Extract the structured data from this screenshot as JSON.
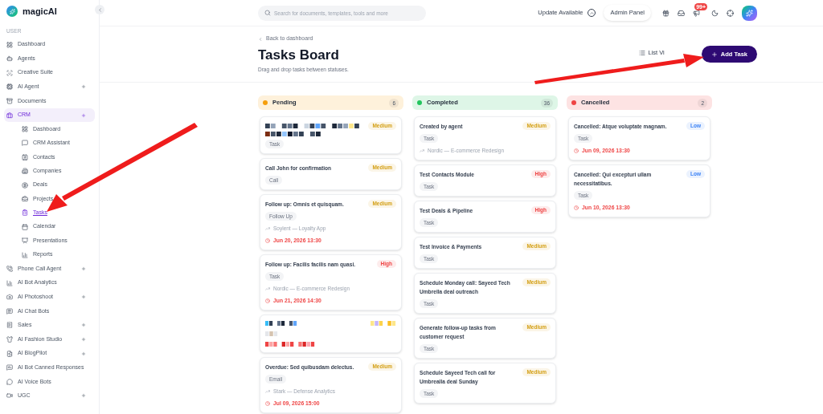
{
  "sidebar": {
    "brand": "magicAI",
    "section": "USER",
    "items": [
      {
        "label": "Dashboard",
        "expandable": false,
        "selected": false
      },
      {
        "label": "Agents",
        "expandable": false,
        "selected": false
      },
      {
        "label": "Creative Suite",
        "expandable": false,
        "selected": false
      },
      {
        "label": "AI Agent",
        "expandable": true,
        "selected": false
      },
      {
        "label": "Documents",
        "expandable": false,
        "selected": false
      },
      {
        "label": "CRM",
        "expandable": true,
        "selected": true,
        "children": [
          {
            "label": "Dashboard",
            "selected": false
          },
          {
            "label": "CRM Assistant",
            "selected": false
          },
          {
            "label": "Contacts",
            "selected": false
          },
          {
            "label": "Companies",
            "selected": false
          },
          {
            "label": "Deals",
            "selected": false
          },
          {
            "label": "Projects",
            "selected": false
          },
          {
            "label": "Tasks",
            "selected": true
          },
          {
            "label": "Calendar",
            "selected": false
          },
          {
            "label": "Presentations",
            "selected": false
          },
          {
            "label": "Reports",
            "selected": false
          }
        ]
      },
      {
        "label": "Phone Call Agent",
        "expandable": true,
        "selected": false
      },
      {
        "label": "AI Bot Analytics",
        "expandable": false,
        "selected": false
      },
      {
        "label": "AI Photoshoot",
        "expandable": true,
        "selected": false
      },
      {
        "label": "AI Chat Bots",
        "expandable": false,
        "selected": false
      },
      {
        "label": "Sales",
        "expandable": true,
        "selected": false
      },
      {
        "label": "AI Fashion Studio",
        "expandable": true,
        "selected": false
      },
      {
        "label": "AI BlogPilot",
        "expandable": true,
        "selected": false
      },
      {
        "label": "AI Bot Canned Responses",
        "expandable": false,
        "selected": false
      },
      {
        "label": "AI Voice Bots",
        "expandable": false,
        "selected": false
      },
      {
        "label": "UGC",
        "expandable": true,
        "selected": false
      }
    ]
  },
  "topbar": {
    "search": {
      "placeholder": "Search for documents, templates, tools and more"
    },
    "update": "Update Available",
    "admin": "Admin Panel",
    "notifications": "99+"
  },
  "page": {
    "back": "Back to dashboard",
    "title": "Tasks Board",
    "subtitle": "Drag and drop tasks between statuses.",
    "list_view": "List Vi",
    "add": "Add Task"
  },
  "columns": [
    {
      "title": "Pending",
      "color": "#f59e0b",
      "count": "6",
      "cards": [
        {
          "kind": "pixelated_title",
          "priority": {
            "label": "Medium",
            "color": "#d4a017"
          },
          "tag": "Task"
        },
        {
          "kind": "task",
          "title": "Call John for confirmation",
          "priority": {
            "label": "Medium",
            "color": "#d4a017"
          },
          "tag": "Call"
        },
        {
          "kind": "task",
          "title": "Follow up: Omnis et quisquam.",
          "priority": {
            "label": "Medium",
            "color": "#d4a017"
          },
          "tag": "Follow Up",
          "project": "Soylent — Loyalty App",
          "due": "Jun 20, 2026 13:30"
        },
        {
          "kind": "task",
          "title": "Follow up: Facilis facilis nam quasi.",
          "priority": {
            "label": "High",
            "color": "#ef4444"
          },
          "tag": "Task",
          "project": "Nordic — E-commerce Redesign",
          "due": "Jun 21, 2026 14:30"
        },
        {
          "kind": "pixelated"
        },
        {
          "kind": "task",
          "title": "Overdue: Sed quibusdam delectus.",
          "priority": {
            "label": "Medium",
            "color": "#d4a017"
          },
          "tag": "Email",
          "project": "Stark — Defense Analytics",
          "due": "Jul 09, 2026 15:00"
        }
      ]
    },
    {
      "title": "Completed",
      "color": "#22c55e",
      "count": "36",
      "cards": [
        {
          "kind": "task",
          "title": "Created by agent",
          "priority": {
            "label": "Medium",
            "color": "#d4a017"
          },
          "tag": "Task",
          "project": "Nordic — E-commerce Redesign"
        },
        {
          "kind": "task",
          "title": "Test Contacts Module",
          "priority": {
            "label": "High",
            "color": "#ef4444"
          },
          "tag": "Task"
        },
        {
          "kind": "task",
          "title": "Test Deals & Pipeline",
          "priority": {
            "label": "High",
            "color": "#ef4444"
          },
          "tag": "Task"
        },
        {
          "kind": "task",
          "title": "Test Invoice & Payments",
          "priority": {
            "label": "Medium",
            "color": "#d4a017"
          },
          "tag": "Task"
        },
        {
          "kind": "task",
          "title": "Schedule Monday call: Sayeed Tech Umbrella deal outreach",
          "priority": {
            "label": "Medium",
            "color": "#d4a017"
          },
          "tag": "Task"
        },
        {
          "kind": "task",
          "title": "Generate follow-up tasks from customer request",
          "priority": {
            "label": "Medium",
            "color": "#d4a017"
          },
          "tag": "Task"
        },
        {
          "kind": "task",
          "title": "Schedule Sayeed Tech call for Umbrealla deal Sunday",
          "priority": {
            "label": "Medium",
            "color": "#d4a017"
          },
          "tag": "Task"
        }
      ]
    },
    {
      "title": "Cancelled",
      "color": "#ef4444",
      "count": "2",
      "cards": [
        {
          "kind": "task",
          "title": "Cancelled: Atque voluptate magnam.",
          "priority": {
            "label": "Low",
            "color": "#3b82f6"
          },
          "tag": "Task",
          "due": "Jun 09, 2026 13:30"
        },
        {
          "kind": "task",
          "title": "Cancelled: Qui excepturi ullam necessitatibus.",
          "priority": {
            "label": "Low",
            "color": "#3b82f6"
          },
          "tag": "Task",
          "due": "Jun 10, 2026 13:30"
        }
      ]
    }
  ]
}
